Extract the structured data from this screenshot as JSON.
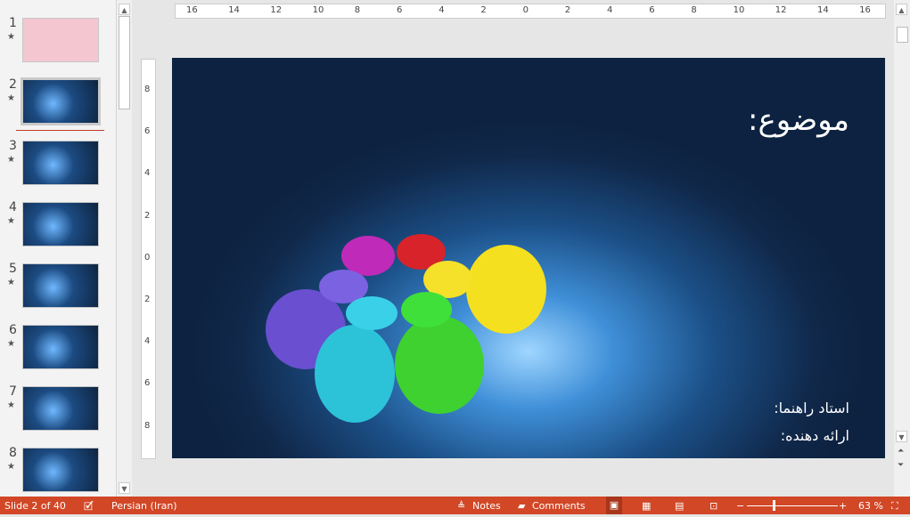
{
  "thumbnails": [
    {
      "num": "1"
    },
    {
      "num": "2",
      "selected": true
    },
    {
      "num": "3"
    },
    {
      "num": "4"
    },
    {
      "num": "5"
    },
    {
      "num": "6"
    },
    {
      "num": "7"
    },
    {
      "num": "8"
    }
  ],
  "ruler": {
    "horizontal": [
      "16",
      "14",
      "12",
      "10",
      "8",
      "6",
      "4",
      "2",
      "0",
      "2",
      "4",
      "6",
      "8",
      "10",
      "12",
      "14",
      "16"
    ],
    "vertical": [
      "8",
      "6",
      "4",
      "2",
      "0",
      "2",
      "4",
      "6",
      "8"
    ]
  },
  "slide": {
    "title": "موضوع:",
    "advisor": "استاد راهنما:",
    "presenter": "ارائه دهنده:"
  },
  "status": {
    "slide": "Slide 2 of 40",
    "language": "Persian (Iran)",
    "notes": "Notes",
    "comments": "Comments",
    "zoom": "63 %",
    "zoom_percent": 63,
    "accent": "#d24726"
  }
}
